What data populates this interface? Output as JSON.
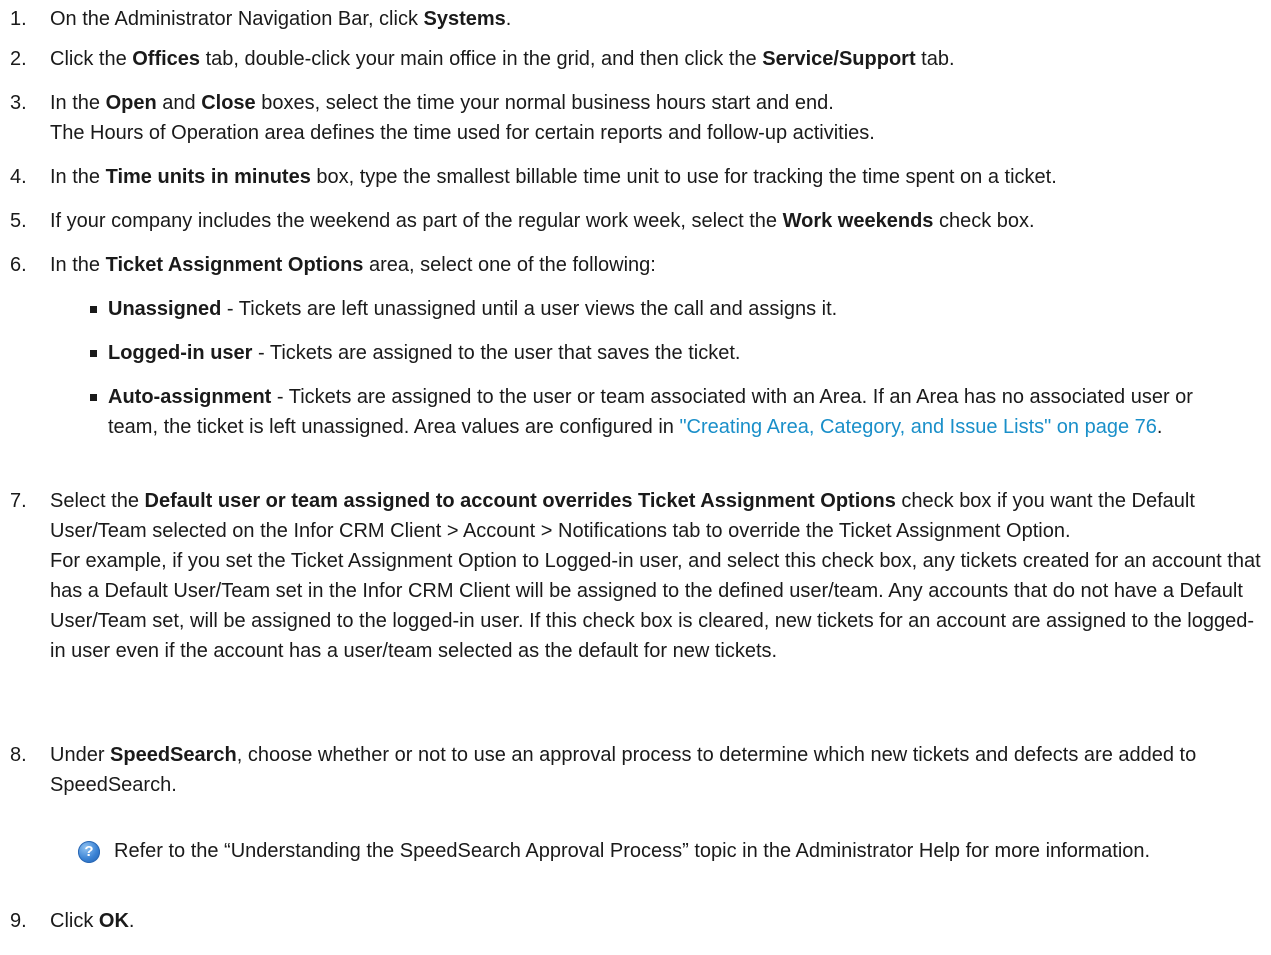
{
  "steps": [
    {
      "num": "1.",
      "parts": [
        {
          "t": "On the Administrator Navigation Bar, click "
        },
        {
          "b": "Systems"
        },
        {
          "t": "."
        }
      ]
    },
    {
      "num": "2.",
      "parts": [
        {
          "t": "Click the "
        },
        {
          "b": "Offices"
        },
        {
          "t": " tab, double-click your main office in the grid, and then click the "
        },
        {
          "b": "Service/Support"
        },
        {
          "t": " tab."
        }
      ]
    },
    {
      "num": "3.",
      "parts": [
        {
          "t": "In the "
        },
        {
          "b": "Open"
        },
        {
          "t": " and "
        },
        {
          "b": "Close"
        },
        {
          "t": " boxes, select the time your normal business hours start and end."
        },
        {
          "br": true
        },
        {
          "t": "The Hours of Operation area defines the time used for certain reports and follow-up activities."
        }
      ]
    },
    {
      "num": "4.",
      "parts": [
        {
          "t": "In the "
        },
        {
          "b": "Time units in minutes"
        },
        {
          "t": " box, type the smallest billable time unit to use for tracking the time spent on a ticket."
        }
      ]
    },
    {
      "num": "5.",
      "parts": [
        {
          "t": "If your company includes the weekend as part of the regular work week, select the "
        },
        {
          "b": "Work weekends"
        },
        {
          "t": " check box."
        }
      ]
    },
    {
      "num": "6.",
      "parts": [
        {
          "t": "In the "
        },
        {
          "b": "Ticket Assignment Options"
        },
        {
          "t": " area, select one of the following:"
        }
      ]
    },
    {
      "num": "7.",
      "parts": [
        {
          "t": "Select the "
        },
        {
          "b": "Default user or team assigned to account overrides Ticket Assignment Options"
        },
        {
          "t": " check box if you want the Default User/Team selected on the Infor CRM Client > Account > Notifications tab to override the Ticket Assignment Option."
        },
        {
          "br": true
        },
        {
          "t": "For example, if you set the Ticket Assignment Option to Logged-in user, and select this check box, any tickets created for an account that has a Default User/Team set in the Infor CRM Client will be assigned to the defined user/team. Any accounts that do not have a Default User/Team set, will be assigned to the logged-in user. If this check box is cleared, new tickets for an account are assigned to the logged-in user even if the account has a user/team selected as the default for new tickets."
        }
      ]
    },
    {
      "num": "8.",
      "parts": [
        {
          "t": "Under "
        },
        {
          "b": "SpeedSearch"
        },
        {
          "t": ", choose whether or not to use an approval process to determine which new tickets and defects are added to SpeedSearch."
        }
      ]
    },
    {
      "num": "9.",
      "parts": [
        {
          "t": "Click "
        },
        {
          "b": "OK"
        },
        {
          "t": "."
        }
      ]
    }
  ],
  "bullets": [
    {
      "parts": [
        {
          "b": "Unassigned"
        },
        {
          "t": " - Tickets are left unassigned until a user views the call and assigns it."
        }
      ]
    },
    {
      "parts": [
        {
          "b": "Logged-in user"
        },
        {
          "t": " - Tickets are assigned to the user that saves the ticket."
        }
      ]
    },
    {
      "parts": [
        {
          "b": "Auto-assignment"
        },
        {
          "t": " - Tickets are assigned to the user or team associated with an Area. If an Area has no associated user or team, the ticket is left unassigned. Area values are configured in "
        },
        {
          "link": "\"Creating Area, Category, and Issue Lists\" on page 76"
        },
        {
          "t": "."
        }
      ]
    }
  ],
  "note": {
    "icon": "help-question-icon",
    "text": "Refer to the “Understanding the SpeedSearch Approval Process” topic in the Administrator Help for more information."
  },
  "colors": {
    "link": "#1a8fc9",
    "text": "#1a1a1a",
    "icon": "#3a82d4"
  }
}
